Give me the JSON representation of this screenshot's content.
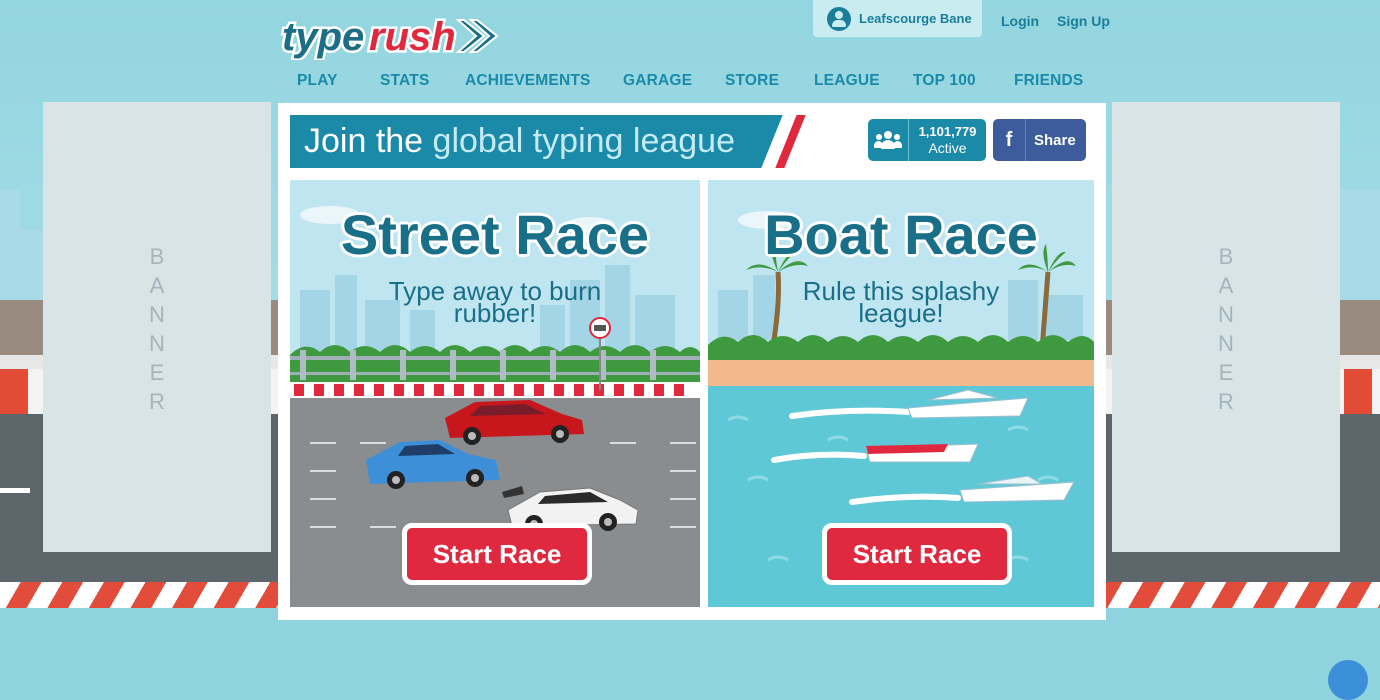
{
  "header": {
    "logo": {
      "part1": "type",
      "part2": "rush"
    },
    "user_name": "Leafscourge Bane",
    "login": "Login",
    "signup": "Sign Up"
  },
  "nav": [
    "PLAY",
    "STATS",
    "ACHIEVEMENTS",
    "GARAGE",
    "STORE",
    "LEAGUE",
    "TOP 100",
    "FRIENDS"
  ],
  "banners": {
    "left": "BANNER",
    "right": "BANNER"
  },
  "league": {
    "prefix": "Join the ",
    "highlight": "global typing league",
    "active_count": "1,101,779",
    "active_label": "Active",
    "share_icon": "f",
    "share_label": "Share"
  },
  "races": {
    "street": {
      "title": "Street Race",
      "sub1": "Type away to burn",
      "sub2": "rubber!",
      "button": "Start Race"
    },
    "boat": {
      "title": "Boat Race",
      "sub1": "Rule this splashy",
      "sub2": "league!",
      "button": "Start Race"
    }
  },
  "colors": {
    "brand": "#1a8aa8",
    "accent_red": "#e0283e",
    "facebook": "#3c5c9c"
  },
  "icons": {
    "user": "user-avatar-icon",
    "people": "people-icon",
    "facebook": "facebook-icon"
  }
}
